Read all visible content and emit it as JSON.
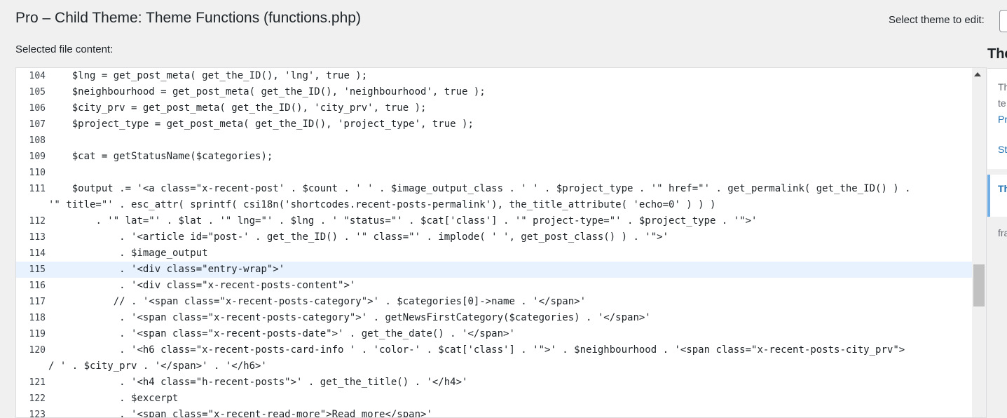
{
  "header": {
    "title": "Pro – Child Theme: Theme Functions (functions.php)",
    "select_label": "Select theme to edit:",
    "file_label": "Selected file content:"
  },
  "right_panel": {
    "heading": "The",
    "box_lines": [
      "Th",
      "te",
      "Pr"
    ],
    "link": "St",
    "active_item": "Th",
    "text": "fra"
  },
  "editor": {
    "active_line": "115",
    "lines": [
      {
        "n": "104",
        "code": "    $lng = get_post_meta( get_the_ID(), 'lng', true );"
      },
      {
        "n": "105",
        "code": "    $neighbourhood = get_post_meta( get_the_ID(), 'neighbourhood', true );"
      },
      {
        "n": "106",
        "code": "    $city_prv = get_post_meta( get_the_ID(), 'city_prv', true );"
      },
      {
        "n": "107",
        "code": "    $project_type = get_post_meta( get_the_ID(), 'project_type', true );"
      },
      {
        "n": "108",
        "code": ""
      },
      {
        "n": "109",
        "code": "    $cat = getStatusName($categories);"
      },
      {
        "n": "110",
        "code": ""
      },
      {
        "n": "111",
        "code": "    $output .= '<a class=\"x-recent-post' . $count . ' ' . $image_output_class . ' ' . $project_type . '\" href=\"' . get_permalink( get_the_ID() ) .\n'\" title=\"' . esc_attr( sprintf( csi18n('shortcodes.recent-posts-permalink'), the_title_attribute( 'echo=0' ) ) )"
      },
      {
        "n": "112",
        "code": "        . '\" lat=\"' . $lat . '\" lng=\"' . $lng . ' \"status=\"' . $cat['class'] . '\" project-type=\"' . $project_type . '\">'"
      },
      {
        "n": "113",
        "code": "            . '<article id=\"post-' . get_the_ID() . '\" class=\"' . implode( ' ', get_post_class() ) . '\">'"
      },
      {
        "n": "114",
        "code": "            . $image_output"
      },
      {
        "n": "115",
        "code": "            . '<div class=\"entry-wrap\">'"
      },
      {
        "n": "116",
        "code": "            . '<div class=\"x-recent-posts-content\">'"
      },
      {
        "n": "117",
        "code": "           // . '<span class=\"x-recent-posts-category\">' . $categories[0]->name . '</span>'"
      },
      {
        "n": "118",
        "code": "            . '<span class=\"x-recent-posts-category\">' . getNewsFirstCategory($categories) . '</span>'"
      },
      {
        "n": "119",
        "code": "            . '<span class=\"x-recent-posts-date\">' . get_the_date() . '</span>'"
      },
      {
        "n": "120",
        "code": "            . '<h6 class=\"x-recent-posts-card-info ' . 'color-' . $cat['class'] . '\">' . $neighbourhood . '<span class=\"x-recent-posts-city_prv\">\n/ ' . $city_prv . '</span>' . '</h6>'"
      },
      {
        "n": "121",
        "code": "            . '<h4 class=\"h-recent-posts\">' . get_the_title() . '</h4>'"
      },
      {
        "n": "122",
        "code": "            . $excerpt"
      },
      {
        "n": "123",
        "code": "            . '<span class=\"x-recent-read-more\">Read more</span>'"
      }
    ]
  }
}
